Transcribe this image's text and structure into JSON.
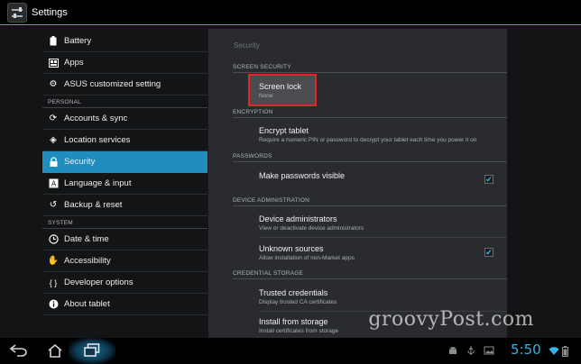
{
  "app": {
    "title": "Settings"
  },
  "sidebar": {
    "items_top": [
      {
        "label": "Battery",
        "icon": "battery-icon"
      },
      {
        "label": "Apps",
        "icon": "apps-icon"
      },
      {
        "label": "ASUS customized setting",
        "icon": "gear-icon"
      }
    ],
    "personal_header": "PERSONAL",
    "personal_items": [
      {
        "label": "Accounts & sync",
        "icon": "sync-icon"
      },
      {
        "label": "Location services",
        "icon": "location-icon"
      },
      {
        "label": "Security",
        "icon": "lock-icon",
        "active": true
      },
      {
        "label": "Language & input",
        "icon": "language-icon"
      },
      {
        "label": "Backup & reset",
        "icon": "backup-icon"
      }
    ],
    "system_header": "SYSTEM",
    "system_items": [
      {
        "label": "Date & time",
        "icon": "clock-icon"
      },
      {
        "label": "Accessibility",
        "icon": "hand-icon"
      },
      {
        "label": "Developer options",
        "icon": "braces-icon"
      },
      {
        "label": "About tablet",
        "icon": "info-icon"
      }
    ]
  },
  "panel": {
    "title": "Security",
    "sections": {
      "screen_security": "SCREEN SECURITY",
      "encryption": "ENCRYPTION",
      "passwords": "PASSWORDS",
      "device_admin": "DEVICE ADMINISTRATION",
      "credential_storage": "CREDENTIAL STORAGE"
    },
    "screen_lock": {
      "title": "Screen lock",
      "summary": "None"
    },
    "encrypt": {
      "title": "Encrypt tablet",
      "summary": "Require a numeric PIN or password to decrypt your tablet each time you power it on"
    },
    "make_passwords": {
      "title": "Make passwords visible",
      "checked": true
    },
    "device_administrators": {
      "title": "Device administrators",
      "summary": "View or deactivate device administrators"
    },
    "unknown_sources": {
      "title": "Unknown sources",
      "summary": "Allow installation of non-Market apps",
      "checked": true
    },
    "trusted_credentials": {
      "title": "Trusted credentials",
      "summary": "Display trusted CA certificates"
    },
    "install_storage": {
      "title": "Install from storage",
      "summary": "Install certificates from storage"
    }
  },
  "watermark": "groovyPost.com",
  "status": {
    "time": "5:50"
  },
  "colors": {
    "accent": "#33b5e5",
    "selected": "#1f8dbd",
    "highlight_border": "#e02727"
  }
}
